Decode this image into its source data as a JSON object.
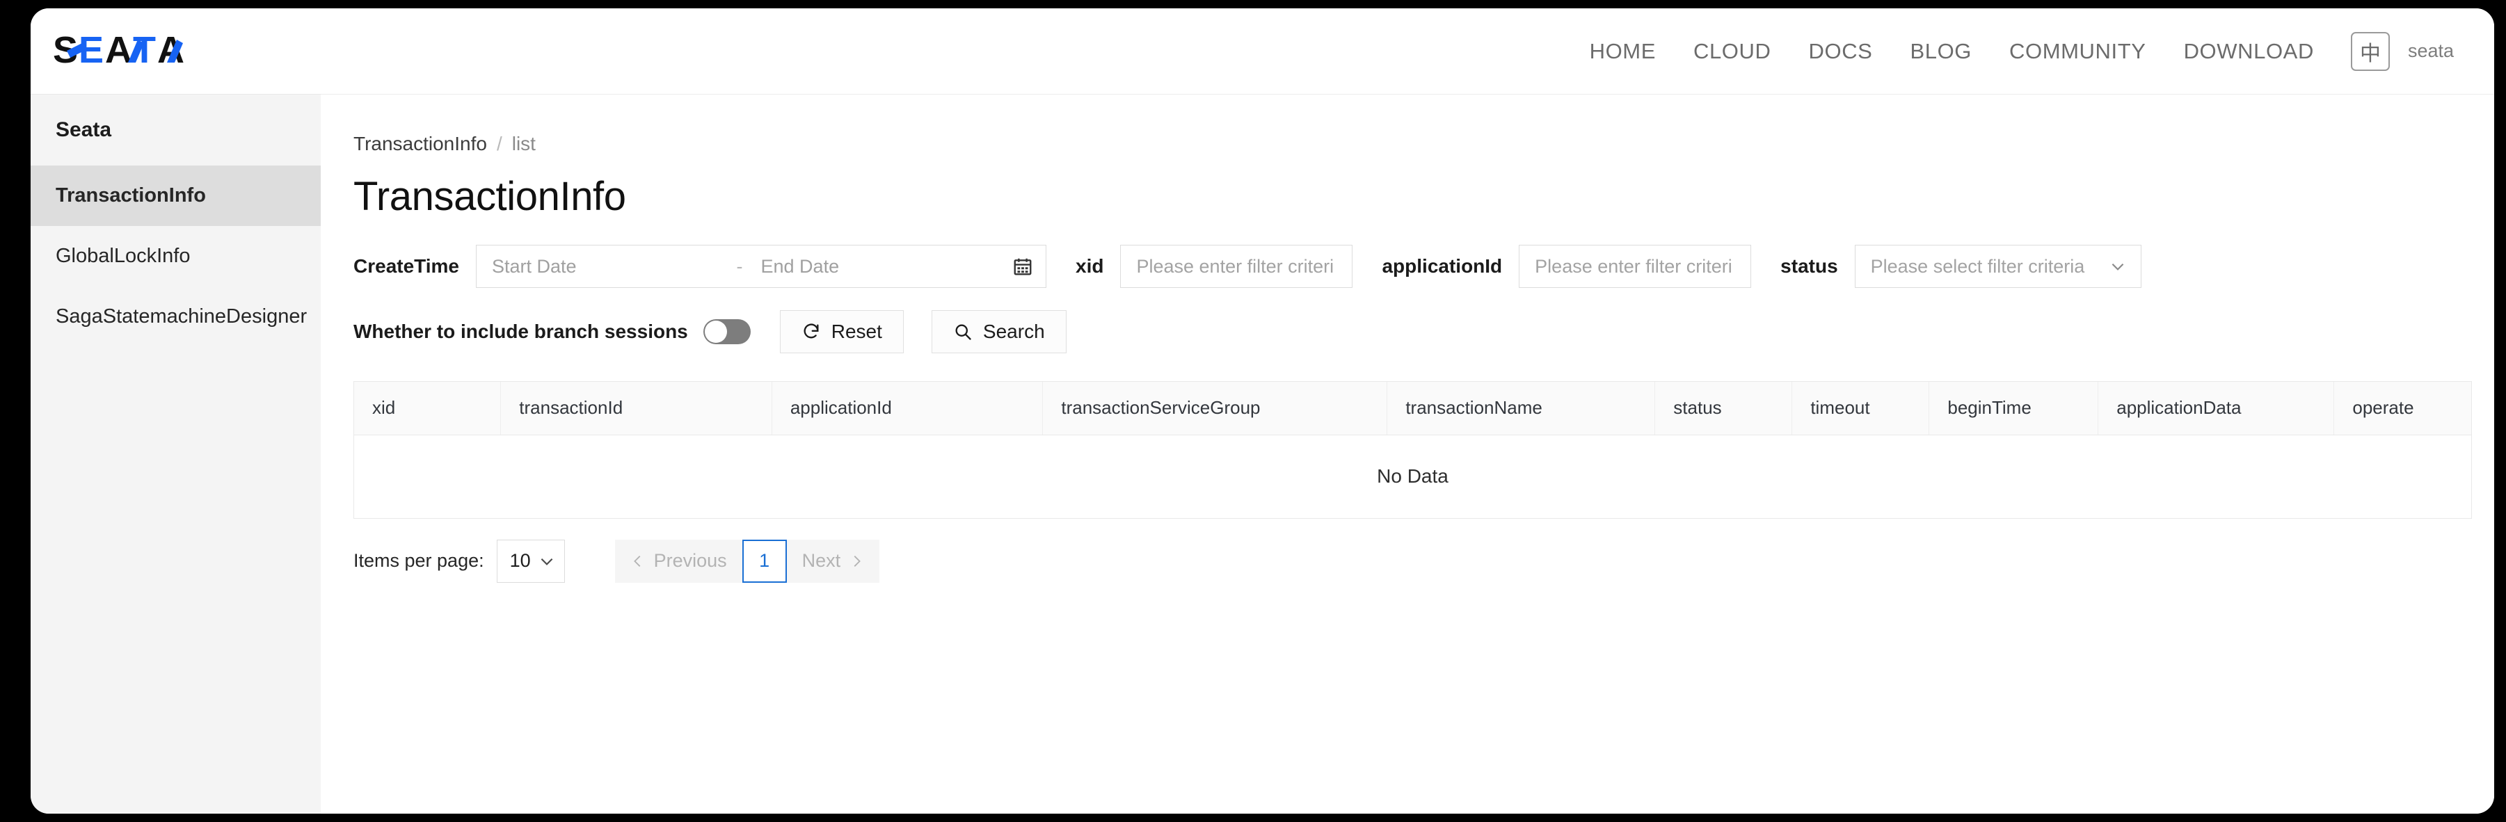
{
  "brand": {
    "logo_text": "SEATA",
    "logo_accent": "#1763f3"
  },
  "topnav": {
    "links": [
      "HOME",
      "CLOUD",
      "DOCS",
      "BLOG",
      "COMMUNITY",
      "DOWNLOAD"
    ],
    "lang_label": "中",
    "user": "seata"
  },
  "sidebar": {
    "title": "Seata",
    "items": [
      {
        "label": "TransactionInfo",
        "active": true
      },
      {
        "label": "GlobalLockInfo",
        "active": false
      },
      {
        "label": "SagaStatemachineDesigner",
        "active": false
      }
    ]
  },
  "breadcrumb": {
    "root": "TransactionInfo",
    "separator": "/",
    "current": "list"
  },
  "page": {
    "title": "TransactionInfo"
  },
  "filters": {
    "createtime_label": "CreateTime",
    "start_date_placeholder": "Start Date",
    "end_date_placeholder": "End Date",
    "range_dash": "-",
    "xid_label": "xid",
    "xid_placeholder": "Please enter filter criteri",
    "applicationid_label": "applicationId",
    "applicationid_placeholder": "Please enter filter criteri",
    "status_label": "status",
    "status_placeholder": "Please select filter criteria",
    "branch_toggle_label": "Whether to include branch sessions",
    "branch_toggle_on": false,
    "reset_label": "Reset",
    "search_label": "Search"
  },
  "table": {
    "columns": [
      "xid",
      "transactionId",
      "applicationId",
      "transactionServiceGroup",
      "transactionName",
      "status",
      "timeout",
      "beginTime",
      "applicationData",
      "operate"
    ],
    "rows": [],
    "empty_text": "No Data"
  },
  "pagination": {
    "items_per_page_label": "Items per page:",
    "items_per_page_value": "10",
    "previous_label": "Previous",
    "next_label": "Next",
    "current_page": "1",
    "accent": "#1a6fd4"
  }
}
